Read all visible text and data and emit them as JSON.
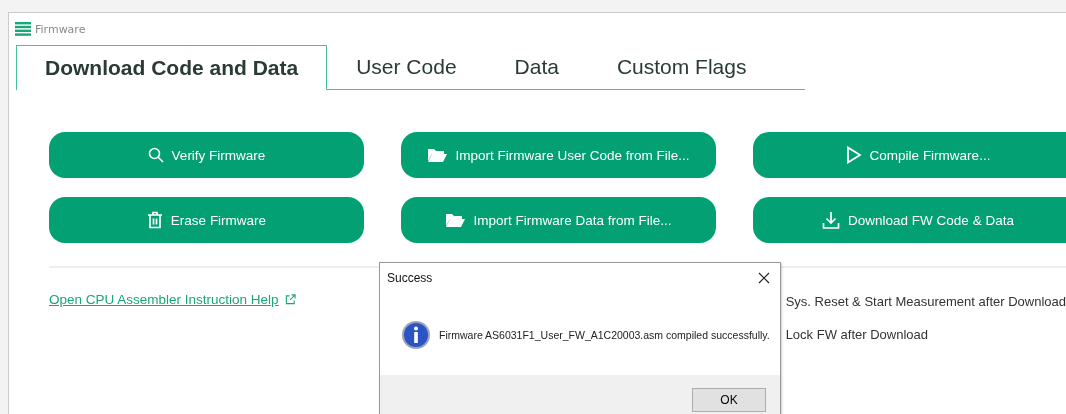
{
  "window": {
    "title": "Firmware"
  },
  "tabs": [
    {
      "label": "Download Code and Data",
      "selected": true
    },
    {
      "label": "User Code",
      "selected": false
    },
    {
      "label": "Data",
      "selected": false
    },
    {
      "label": "Custom Flags",
      "selected": false
    }
  ],
  "buttons": [
    {
      "label": "Verify Firmware",
      "kind": "search"
    },
    {
      "label": "Import Firmware User Code from File...",
      "kind": "folder"
    },
    {
      "label": "Compile Firmware...",
      "kind": "play"
    },
    {
      "label": "Erase Firmware",
      "kind": "trash"
    },
    {
      "label": "Import Firmware Data from File...",
      "kind": "folder"
    },
    {
      "label": "Download FW Code & Data",
      "kind": "download"
    }
  ],
  "help_link": "Open CPU Assembler Instruction Help",
  "options": [
    "Sys. Reset & Start Measurement after Download",
    "Lock FW after Download"
  ],
  "dialog": {
    "title": "Success",
    "message": "Firmware AS6031F1_User_FW_A1C20003.asm compiled successfully.",
    "button": "OK"
  }
}
